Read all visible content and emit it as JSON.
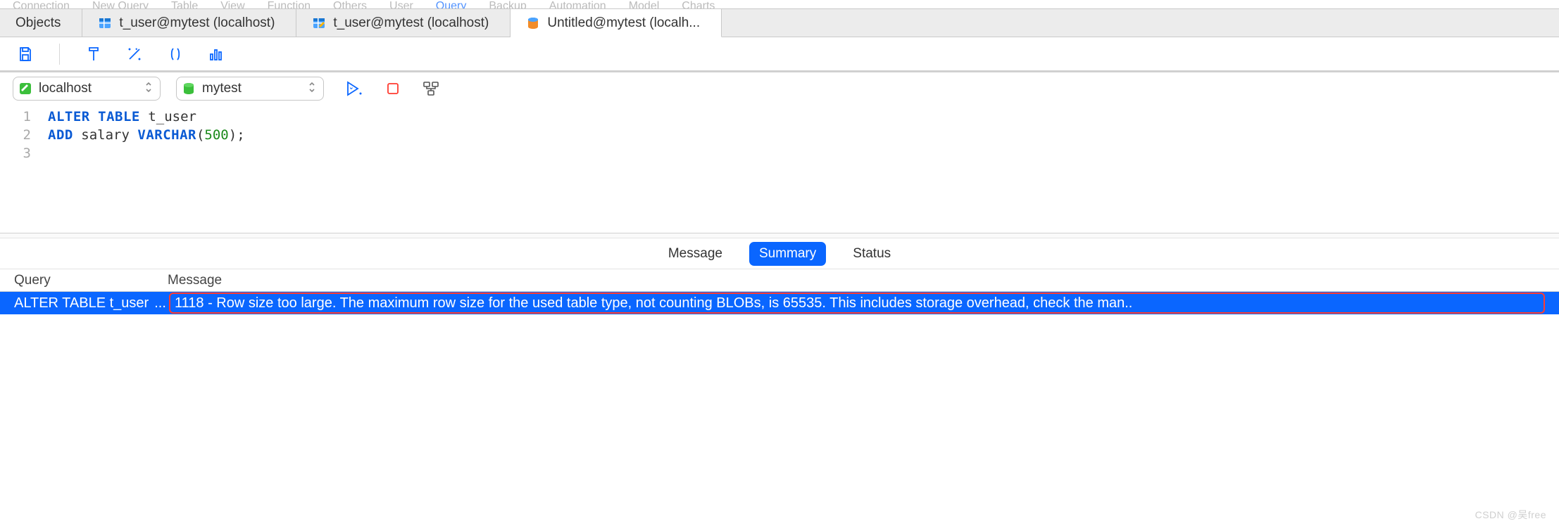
{
  "tabs": [
    {
      "label": "Objects"
    },
    {
      "label": "t_user@mytest (localhost)"
    },
    {
      "label": "t_user@mytest (localhost)"
    },
    {
      "label": "Untitled@mytest (localh..."
    }
  ],
  "active_tab_index": 3,
  "connection_dropdown": {
    "label": "localhost"
  },
  "database_dropdown": {
    "label": "mytest"
  },
  "code_lines": [
    {
      "n": "1",
      "kw1": "ALTER",
      "kw2": "TABLE",
      "ident": "t_user"
    },
    {
      "n": "2",
      "kw1": "ADD",
      "ident": "salary",
      "type": "VARCHAR",
      "num": "500",
      "tail": ";"
    },
    {
      "n": "3"
    }
  ],
  "result_tabs": {
    "message": "Message",
    "summary": "Summary",
    "status": "Status",
    "active": "summary"
  },
  "grid": {
    "headers": {
      "query": "Query",
      "message": "Message"
    },
    "row": {
      "query": "ALTER TABLE t_user",
      "ellipsis": "...",
      "message": "1118 - Row size too large. The maximum row size for the used table type, not counting BLOBs, is 65535. This includes storage overhead, check the man.."
    }
  },
  "watermark": "CSDN @吴free"
}
